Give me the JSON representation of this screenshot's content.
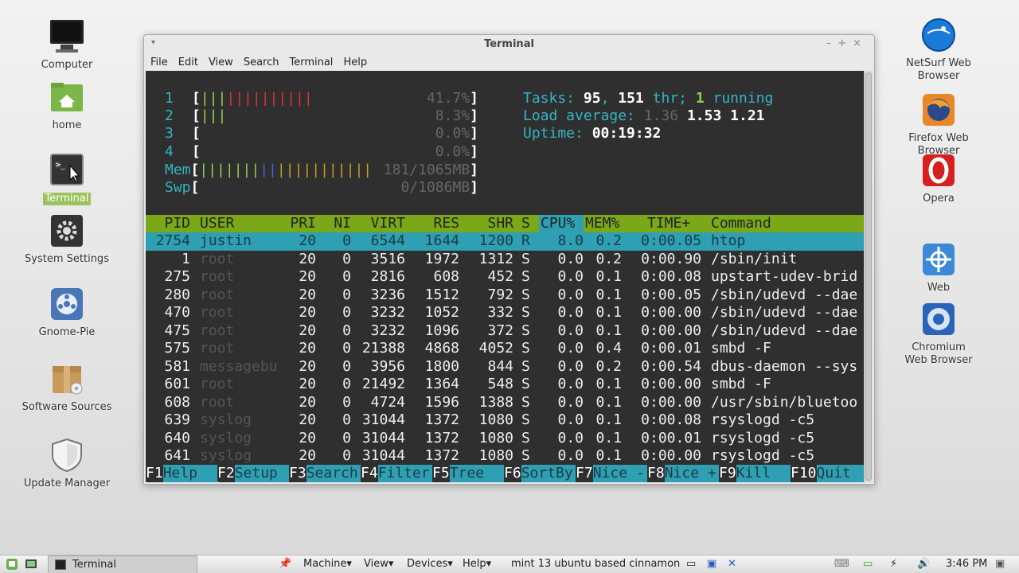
{
  "desktop": {
    "left_icons": [
      {
        "label": "Computer",
        "icon": "computer-icon"
      },
      {
        "label": "home",
        "icon": "home-folder-icon"
      },
      {
        "label": "Terminal",
        "icon": "terminal-icon"
      },
      {
        "label": "System Settings",
        "icon": "settings-icon"
      },
      {
        "label": "Gnome-Pie",
        "icon": "gnome-pie-icon"
      },
      {
        "label": "Software Sources",
        "icon": "package-icon"
      },
      {
        "label": "Update Manager",
        "icon": "shield-icon"
      }
    ],
    "right_icons": [
      {
        "label": "NetSurf Web Browser",
        "icon": "netsurf-icon"
      },
      {
        "label": "Firefox Web Browser",
        "icon": "firefox-icon"
      },
      {
        "label": "Opera",
        "icon": "opera-icon"
      },
      {
        "label": "Web",
        "icon": "web-icon"
      },
      {
        "label": "Chromium Web Browser",
        "icon": "chromium-icon"
      }
    ]
  },
  "window": {
    "title": "Terminal",
    "menu": [
      "File",
      "Edit",
      "View",
      "Search",
      "Terminal",
      "Help"
    ]
  },
  "htop": {
    "cpus": [
      {
        "id": "1",
        "pct": "41.7%",
        "level": 0.417
      },
      {
        "id": "2",
        "pct": "8.3%",
        "level": 0.083
      },
      {
        "id": "3",
        "pct": "0.0%",
        "level": 0
      },
      {
        "id": "4",
        "pct": "0.0%",
        "level": 0
      }
    ],
    "mem": {
      "label": "Mem",
      "value": "181/1065MB"
    },
    "swp": {
      "label": "Swp",
      "value": "0/1086MB"
    },
    "tasks_label": "Tasks:",
    "tasks": "95",
    "threads": "151",
    "thr_label": "thr;",
    "running": "1",
    "running_label": "running",
    "load_label": "Load average:",
    "load1": "1.36",
    "load5": "1.53",
    "load15": "1.21",
    "uptime_label": "Uptime:",
    "uptime": "00:19:32",
    "columns": [
      "PID",
      "USER",
      "PRI",
      "NI",
      "VIRT",
      "RES",
      "SHR",
      "S",
      "CPU%",
      "MEM%",
      "TIME+",
      "Command"
    ],
    "processes": [
      {
        "pid": "2754",
        "user": "justin",
        "pri": "20",
        "ni": "0",
        "virt": "6544",
        "res": "1644",
        "shr": "1200",
        "s": "R",
        "cpu": "8.0",
        "mem": "0.2",
        "time": "0:00.05",
        "cmd": "htop"
      },
      {
        "pid": "1",
        "user": "root",
        "pri": "20",
        "ni": "0",
        "virt": "3516",
        "res": "1972",
        "shr": "1312",
        "s": "S",
        "cpu": "0.0",
        "mem": "0.2",
        "time": "0:00.90",
        "cmd": "/sbin/init"
      },
      {
        "pid": "275",
        "user": "root",
        "pri": "20",
        "ni": "0",
        "virt": "2816",
        "res": "608",
        "shr": "452",
        "s": "S",
        "cpu": "0.0",
        "mem": "0.1",
        "time": "0:00.08",
        "cmd": "upstart-udev-brid"
      },
      {
        "pid": "280",
        "user": "root",
        "pri": "20",
        "ni": "0",
        "virt": "3236",
        "res": "1512",
        "shr": "792",
        "s": "S",
        "cpu": "0.0",
        "mem": "0.1",
        "time": "0:00.05",
        "cmd": "/sbin/udevd --dae"
      },
      {
        "pid": "470",
        "user": "root",
        "pri": "20",
        "ni": "0",
        "virt": "3232",
        "res": "1052",
        "shr": "332",
        "s": "S",
        "cpu": "0.0",
        "mem": "0.1",
        "time": "0:00.00",
        "cmd": "/sbin/udevd --dae"
      },
      {
        "pid": "475",
        "user": "root",
        "pri": "20",
        "ni": "0",
        "virt": "3232",
        "res": "1096",
        "shr": "372",
        "s": "S",
        "cpu": "0.0",
        "mem": "0.1",
        "time": "0:00.00",
        "cmd": "/sbin/udevd --dae"
      },
      {
        "pid": "575",
        "user": "root",
        "pri": "20",
        "ni": "0",
        "virt": "21388",
        "res": "4868",
        "shr": "4052",
        "s": "S",
        "cpu": "0.0",
        "mem": "0.4",
        "time": "0:00.01",
        "cmd": "smbd -F"
      },
      {
        "pid": "581",
        "user": "messagebu",
        "pri": "20",
        "ni": "0",
        "virt": "3956",
        "res": "1800",
        "shr": "844",
        "s": "S",
        "cpu": "0.0",
        "mem": "0.2",
        "time": "0:00.54",
        "cmd": "dbus-daemon --sys"
      },
      {
        "pid": "601",
        "user": "root",
        "pri": "20",
        "ni": "0",
        "virt": "21492",
        "res": "1364",
        "shr": "548",
        "s": "S",
        "cpu": "0.0",
        "mem": "0.1",
        "time": "0:00.00",
        "cmd": "smbd -F"
      },
      {
        "pid": "608",
        "user": "root",
        "pri": "20",
        "ni": "0",
        "virt": "4724",
        "res": "1596",
        "shr": "1388",
        "s": "S",
        "cpu": "0.0",
        "mem": "0.1",
        "time": "0:00.00",
        "cmd": "/usr/sbin/bluetoo"
      },
      {
        "pid": "639",
        "user": "syslog",
        "pri": "20",
        "ni": "0",
        "virt": "31044",
        "res": "1372",
        "shr": "1080",
        "s": "S",
        "cpu": "0.0",
        "mem": "0.1",
        "time": "0:00.08",
        "cmd": "rsyslogd -c5"
      },
      {
        "pid": "640",
        "user": "syslog",
        "pri": "20",
        "ni": "0",
        "virt": "31044",
        "res": "1372",
        "shr": "1080",
        "s": "S",
        "cpu": "0.0",
        "mem": "0.1",
        "time": "0:00.01",
        "cmd": "rsyslogd -c5"
      },
      {
        "pid": "641",
        "user": "syslog",
        "pri": "20",
        "ni": "0",
        "virt": "31044",
        "res": "1372",
        "shr": "1080",
        "s": "S",
        "cpu": "0.0",
        "mem": "0.1",
        "time": "0:00.00",
        "cmd": "rsyslogd -c5"
      }
    ],
    "fkeys": [
      {
        "key": "F1",
        "label": "Help"
      },
      {
        "key": "F2",
        "label": "Setup"
      },
      {
        "key": "F3",
        "label": "Search"
      },
      {
        "key": "F4",
        "label": "Filter"
      },
      {
        "key": "F5",
        "label": "Tree"
      },
      {
        "key": "F6",
        "label": "SortBy"
      },
      {
        "key": "F7",
        "label": "Nice -"
      },
      {
        "key": "F8",
        "label": "Nice +"
      },
      {
        "key": "F9",
        "label": "Kill"
      },
      {
        "key": "F10",
        "label": "Quit"
      }
    ]
  },
  "taskbar": {
    "window_button": "Terminal",
    "vbox_menu": [
      "Machine",
      "View",
      "Devices",
      "Help"
    ],
    "vm_name": "mint 13 ubuntu based cinnamon",
    "clock": "3:46 PM"
  }
}
